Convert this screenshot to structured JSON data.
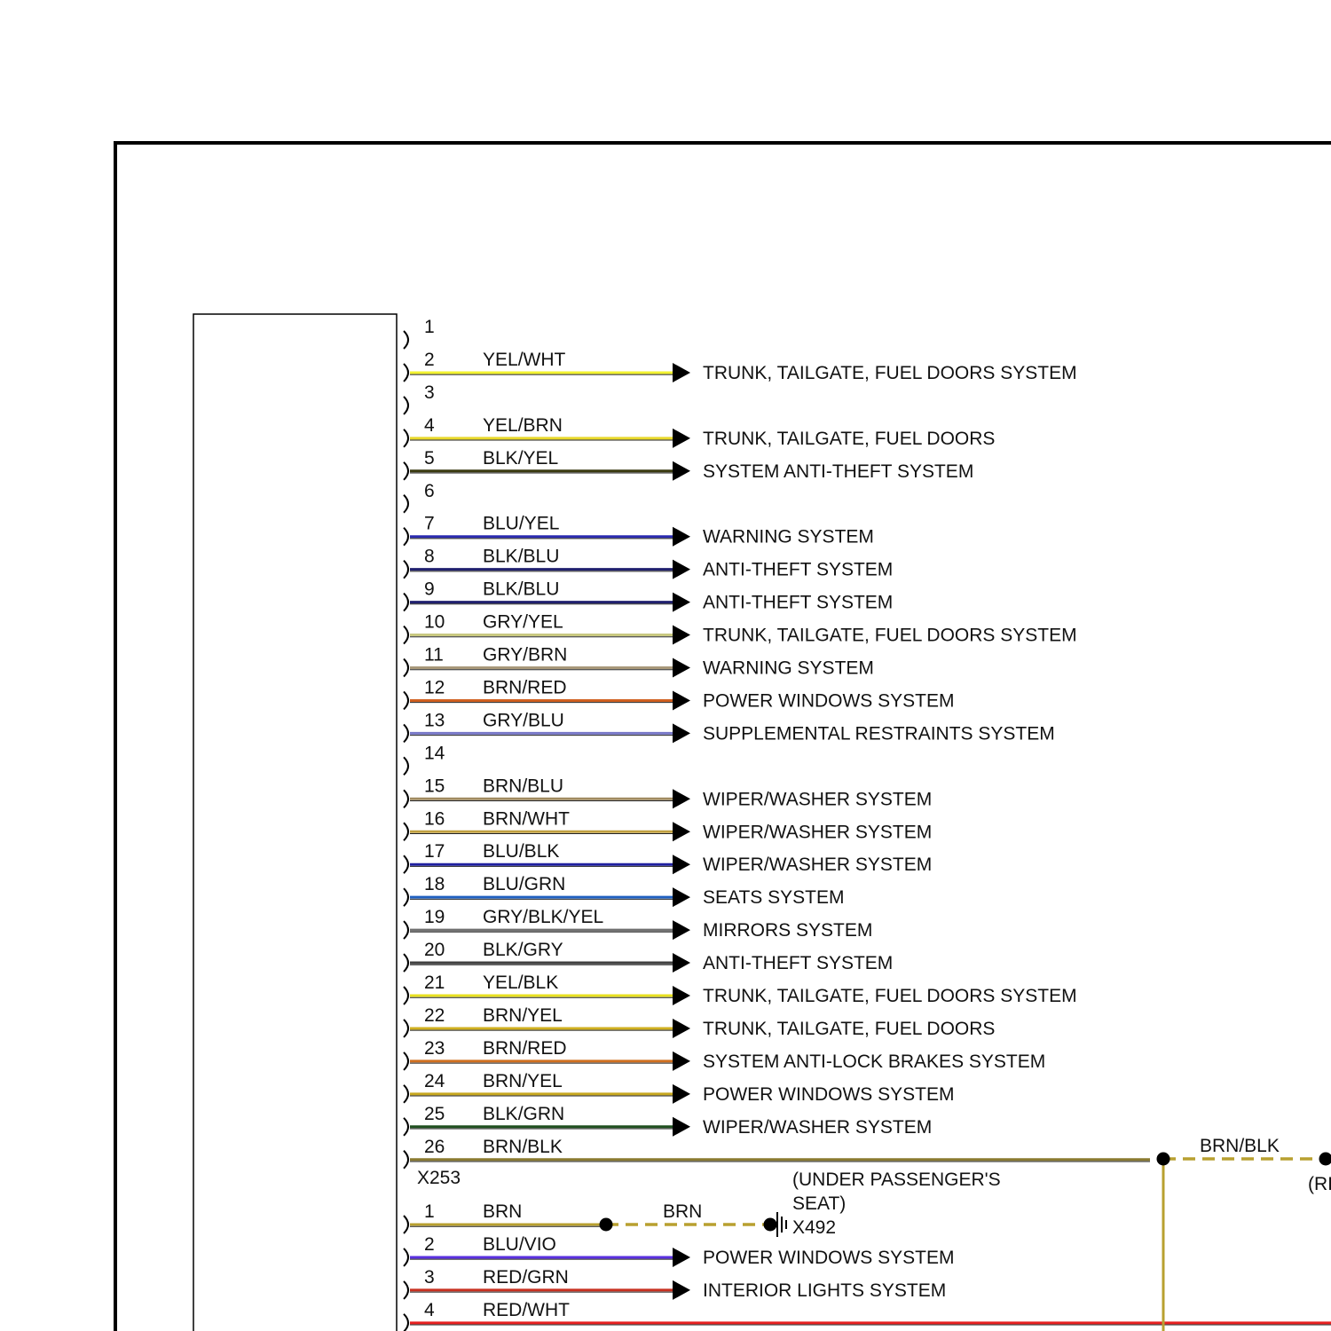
{
  "connectors": [
    {
      "name": "",
      "pins": [
        {
          "num": "1",
          "wire": "",
          "color": "",
          "dest": ""
        },
        {
          "num": "2",
          "wire": "YEL/WHT",
          "color": "#f2f230",
          "dest": "TRUNK, TAILGATE, FUEL DOORS SYSTEM"
        },
        {
          "num": "3",
          "wire": "",
          "color": "",
          "dest": ""
        },
        {
          "num": "4",
          "wire": "YEL/BRN",
          "color": "#e8d82a",
          "dest": "TRUNK, TAILGATE, FUEL DOORS"
        },
        {
          "num": "5",
          "wire": "BLK/YEL",
          "color": "#3a3a10",
          "dest": "SYSTEM ANTI-THEFT SYSTEM"
        },
        {
          "num": "6",
          "wire": "",
          "color": "",
          "dest": ""
        },
        {
          "num": "7",
          "wire": "BLU/YEL",
          "color": "#2a2ab0",
          "dest": "WARNING SYSTEM"
        },
        {
          "num": "8",
          "wire": "BLK/BLU",
          "color": "#20206e",
          "dest": "ANTI-THEFT SYSTEM"
        },
        {
          "num": "9",
          "wire": "BLK/BLU",
          "color": "#20206e",
          "dest": "ANTI-THEFT SYSTEM"
        },
        {
          "num": "10",
          "wire": "GRY/YEL",
          "color": "#c8c880",
          "dest": "TRUNK, TAILGATE, FUEL DOORS SYSTEM"
        },
        {
          "num": "11",
          "wire": "GRY/BRN",
          "color": "#a8987a",
          "dest": "WARNING SYSTEM"
        },
        {
          "num": "12",
          "wire": "BRN/RED",
          "color": "#d06020",
          "dest": "POWER WINDOWS SYSTEM"
        },
        {
          "num": "13",
          "wire": "GRY/BLU",
          "color": "#7878c8",
          "dest": "SUPPLEMENTAL RESTRAINTS SYSTEM"
        },
        {
          "num": "14",
          "wire": "",
          "color": "",
          "dest": ""
        },
        {
          "num": "15",
          "wire": "BRN/BLU",
          "color": "#a08a60",
          "dest": "WIPER/WASHER SYSTEM"
        },
        {
          "num": "16",
          "wire": "BRN/WHT",
          "color": "#c0a040",
          "dest": "WIPER/WASHER SYSTEM"
        },
        {
          "num": "17",
          "wire": "BLU/BLK",
          "color": "#2020a0",
          "dest": "WIPER/WASHER SYSTEM"
        },
        {
          "num": "18",
          "wire": "BLU/GRN",
          "color": "#2060c0",
          "dest": "SEATS SYSTEM"
        },
        {
          "num": "19",
          "wire": "GRY/BLK/YEL",
          "color": "#707070",
          "dest": "MIRRORS SYSTEM"
        },
        {
          "num": "20",
          "wire": "BLK/GRY",
          "color": "#404040",
          "dest": "ANTI-THEFT SYSTEM"
        },
        {
          "num": "21",
          "wire": "YEL/BLK",
          "color": "#e8e020",
          "dest": "TRUNK, TAILGATE, FUEL DOORS SYSTEM"
        },
        {
          "num": "22",
          "wire": "BRN/YEL",
          "color": "#d0b020",
          "dest": "TRUNK, TAILGATE, FUEL DOORS"
        },
        {
          "num": "23",
          "wire": "BRN/RED",
          "color": "#d07020",
          "dest": "SYSTEM ANTI-LOCK BRAKES SYSTEM"
        },
        {
          "num": "24",
          "wire": "BRN/YEL",
          "color": "#c8a820",
          "dest": "POWER WINDOWS SYSTEM"
        },
        {
          "num": "25",
          "wire": "BLK/GRN",
          "color": "#205020",
          "dest": "WIPER/WASHER SYSTEM"
        },
        {
          "num": "26",
          "wire": "BRN/BLK",
          "color": "#8a7a30",
          "dest": ""
        }
      ]
    },
    {
      "name": "X253",
      "pins": [
        {
          "num": "1",
          "wire": "BRN",
          "color": "#b8a030",
          "dest": ""
        },
        {
          "num": "2",
          "wire": "BLU/VIO",
          "color": "#5a30e0",
          "dest": "POWER WINDOWS SYSTEM"
        },
        {
          "num": "3",
          "wire": "RED/GRN",
          "color": "#c83020",
          "dest": "INTERIOR LIGHTS SYSTEM"
        },
        {
          "num": "4",
          "wire": "RED/WHT",
          "color": "#e82020",
          "dest": ""
        }
      ]
    }
  ],
  "splice_wire_label": "BRN/BLK",
  "splice_right_label": "(RI",
  "ground": {
    "wire_label": "BRN",
    "location_line1": "(UNDER PASSENGER'S",
    "location_line2": "SEAT)",
    "name": "X492"
  },
  "colors": {
    "frame": "#000000",
    "splice_wire": "#b8a030"
  }
}
